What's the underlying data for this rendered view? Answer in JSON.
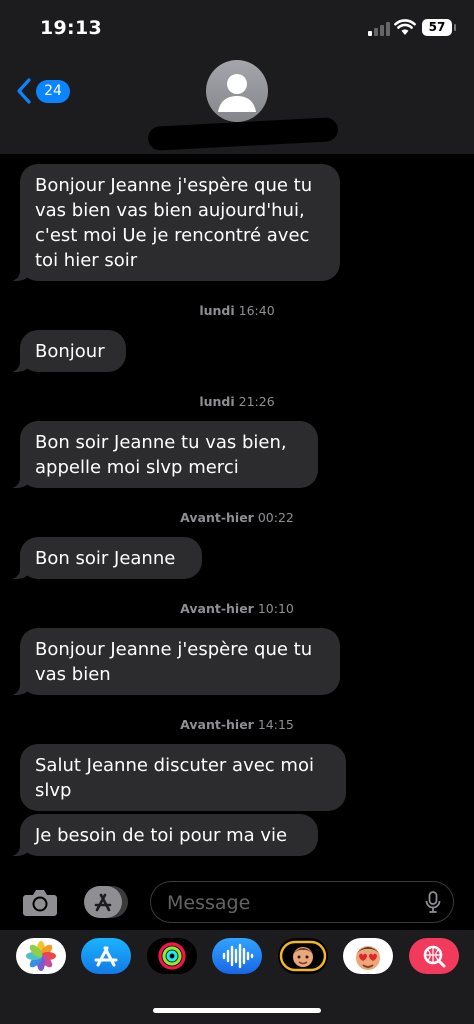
{
  "status_bar": {
    "time": "19:13",
    "battery": "57"
  },
  "header": {
    "back_count": "24"
  },
  "messages": [
    {
      "text": "Bonjour Jeanne j'espère que tu vas bien vas bien  aujourd'hui, c'est moi Ue je rencontré avec toi hier soir"
    },
    {
      "stamp_day": "lundi",
      "stamp_time": "16:40"
    },
    {
      "text": "Bonjour"
    },
    {
      "stamp_day": "lundi",
      "stamp_time": "21:26"
    },
    {
      "text": "Bon soir Jeanne tu vas bien, appelle moi slvp merci"
    },
    {
      "stamp_day": "Avant-hier",
      "stamp_time": "00:22"
    },
    {
      "text": "Bon soir Jeanne"
    },
    {
      "stamp_day": "Avant-hier",
      "stamp_time": "10:10"
    },
    {
      "text": "Bonjour Jeanne j'espère que tu vas bien"
    },
    {
      "stamp_day": "Avant-hier",
      "stamp_time": "14:15"
    },
    {
      "text": "Salut  Jeanne discuter avec moi slvp"
    },
    {
      "text": "Je besoin de toi  pour ma vie"
    }
  ],
  "composer": {
    "placeholder": "Message"
  },
  "app_drawer": [
    {
      "icon": "photos-icon"
    },
    {
      "icon": "app-store-icon"
    },
    {
      "icon": "activity-icon"
    },
    {
      "icon": "audio-message-icon"
    },
    {
      "icon": "memoji-icon"
    },
    {
      "icon": "memoji-stickers-icon"
    },
    {
      "icon": "image-search-icon"
    }
  ],
  "colors": {
    "accent": "#0a84ff",
    "bubble": "#2c2c2e",
    "bar": "#1c1c1e"
  }
}
